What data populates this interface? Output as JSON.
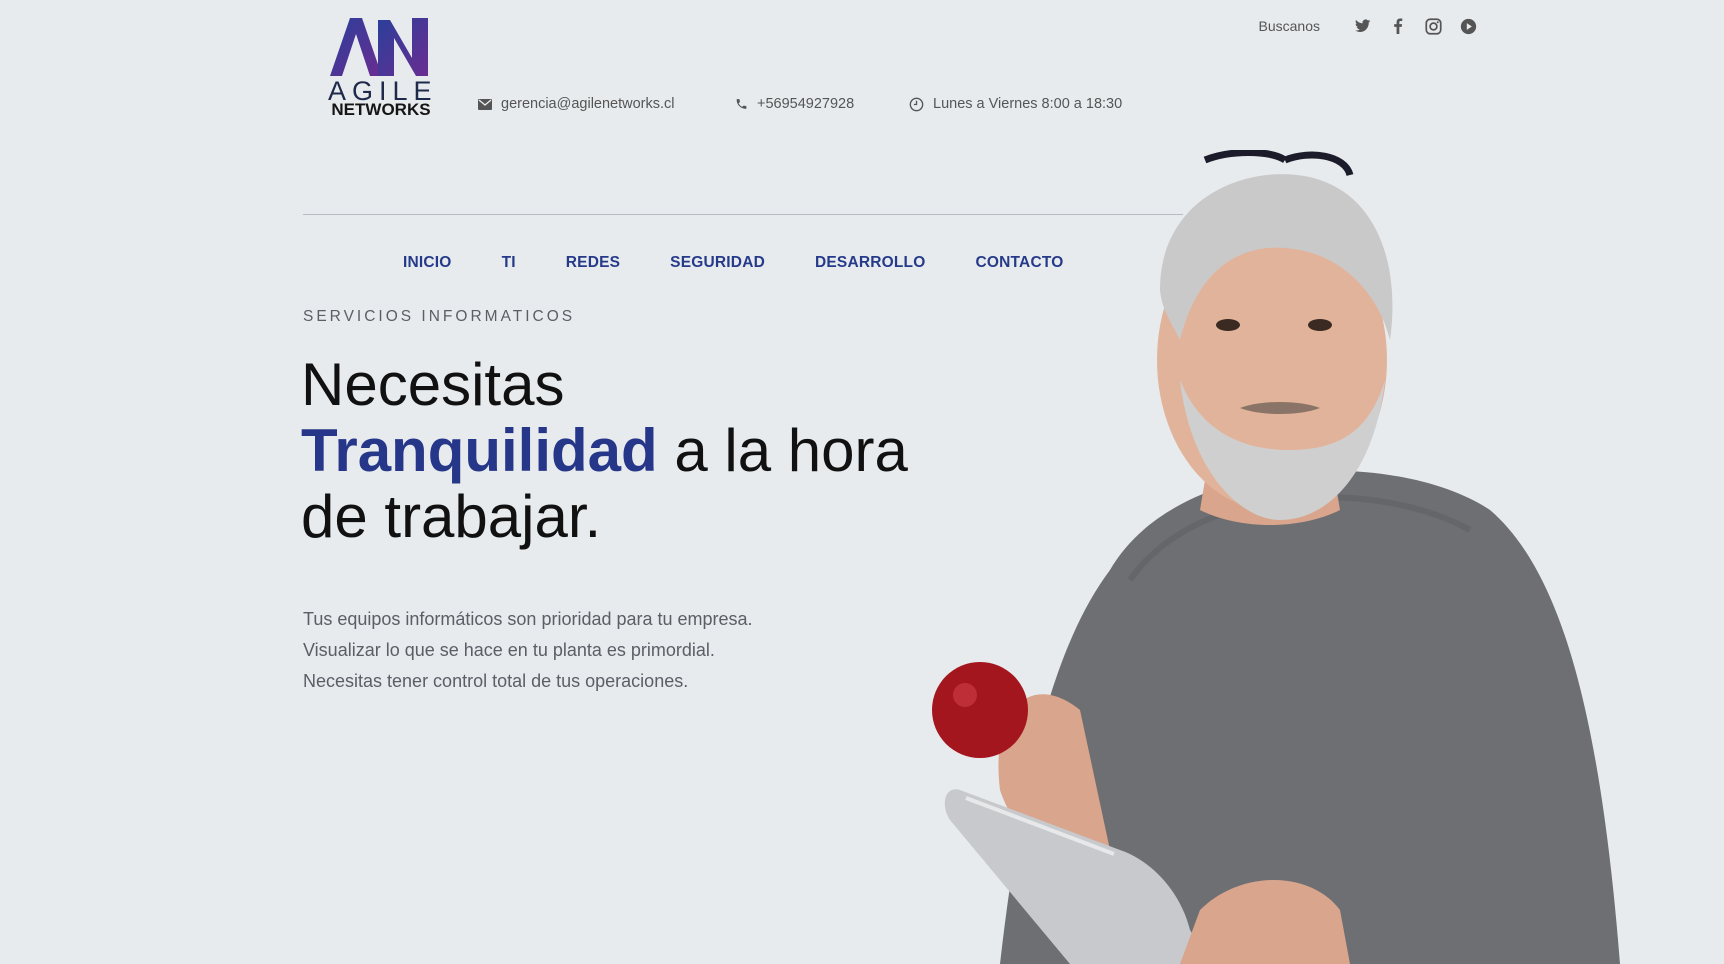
{
  "brand": {
    "logo_word_top": "AGILE",
    "logo_word_bottom": "NETWORKS",
    "logo_icon": "agile-networks-monogram-icon",
    "colors": {
      "primary": "#26378a",
      "accent_purple": "#5a2f8f",
      "background": "#e7ebee"
    }
  },
  "topbar": {
    "follow_label": "Buscanos",
    "socials": [
      "twitter-icon",
      "facebook-icon",
      "instagram-icon",
      "youtube-icon"
    ]
  },
  "contact": {
    "email": "gerencia@agilenetworks.cl",
    "phone": "+56954927928",
    "hours": "Lunes a Viernes 8:00 a 18:30"
  },
  "nav": {
    "items": [
      {
        "label": "INICIO"
      },
      {
        "label": "TI"
      },
      {
        "label": "REDES"
      },
      {
        "label": "SEGURIDAD"
      },
      {
        "label": "DESARROLLO"
      },
      {
        "label": "CONTACTO"
      }
    ]
  },
  "hero": {
    "eyebrow": "SERVICIOS INFORMATICOS",
    "headline_line1": "Necesitas",
    "headline_highlight": "Tranquilidad",
    "headline_line2_rest": " a la hora",
    "headline_line3": "de trabajar.",
    "body_lines": [
      "Tus equipos informáticos son prioridad para tu empresa.",
      "Visualizar lo que se hace en tu planta es primordial.",
      "Necesitas tener control total de tus operaciones."
    ]
  }
}
